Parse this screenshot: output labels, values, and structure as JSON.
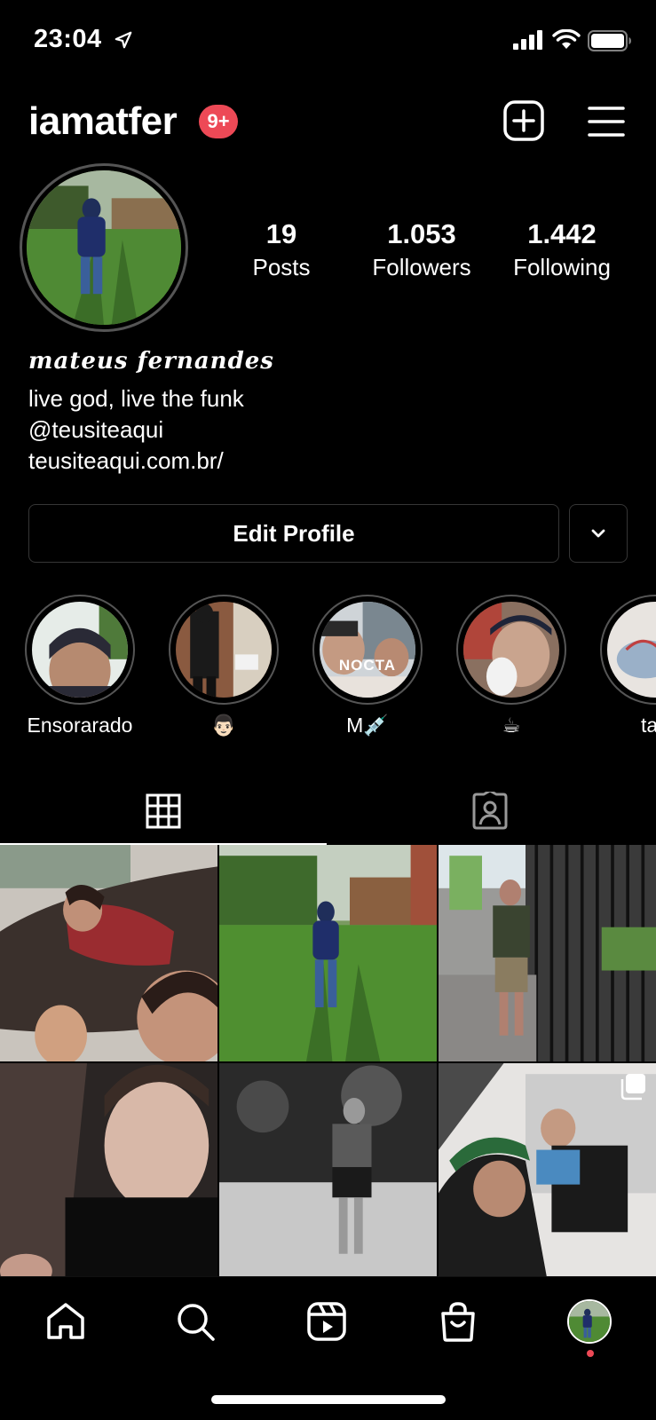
{
  "status_bar": {
    "time": "23:04"
  },
  "header": {
    "username": "iamatfer",
    "badge": "9+"
  },
  "stats": {
    "posts": {
      "value": "19",
      "label": "Posts"
    },
    "followers": {
      "value": "1.053",
      "label": "Followers"
    },
    "following": {
      "value": "1.442",
      "label": "Following"
    }
  },
  "bio": {
    "display_name": "mateus fernandes",
    "line1": "live god, live the funk",
    "mention": "@teusiteaqui",
    "link": "teusiteaqui.com.br/"
  },
  "buttons": {
    "edit_profile": "Edit Profile"
  },
  "highlights": [
    {
      "label": "Ensorarado"
    },
    {
      "label": "👨🏻"
    },
    {
      "label": "M💉"
    },
    {
      "label": "☕"
    },
    {
      "label": "tatt"
    }
  ],
  "highlight_overlay_text": "NOCTA",
  "icons": {
    "location": "location-arrow-icon",
    "signal": "signal-icon",
    "wifi": "wifi-icon",
    "battery": "battery-icon",
    "new_post": "plus-square-icon",
    "menu": "hamburger-menu-icon",
    "chevron": "chevron-down-icon",
    "grid_tab": "grid-icon",
    "tagged_tab": "tagged-person-icon",
    "home": "home-icon",
    "search": "search-icon",
    "reels": "reels-icon",
    "shop": "shop-bag-icon",
    "multi": "multiple-photos-icon"
  },
  "colors": {
    "background": "#000000",
    "badge": "#ed4956",
    "border": "#363636"
  }
}
